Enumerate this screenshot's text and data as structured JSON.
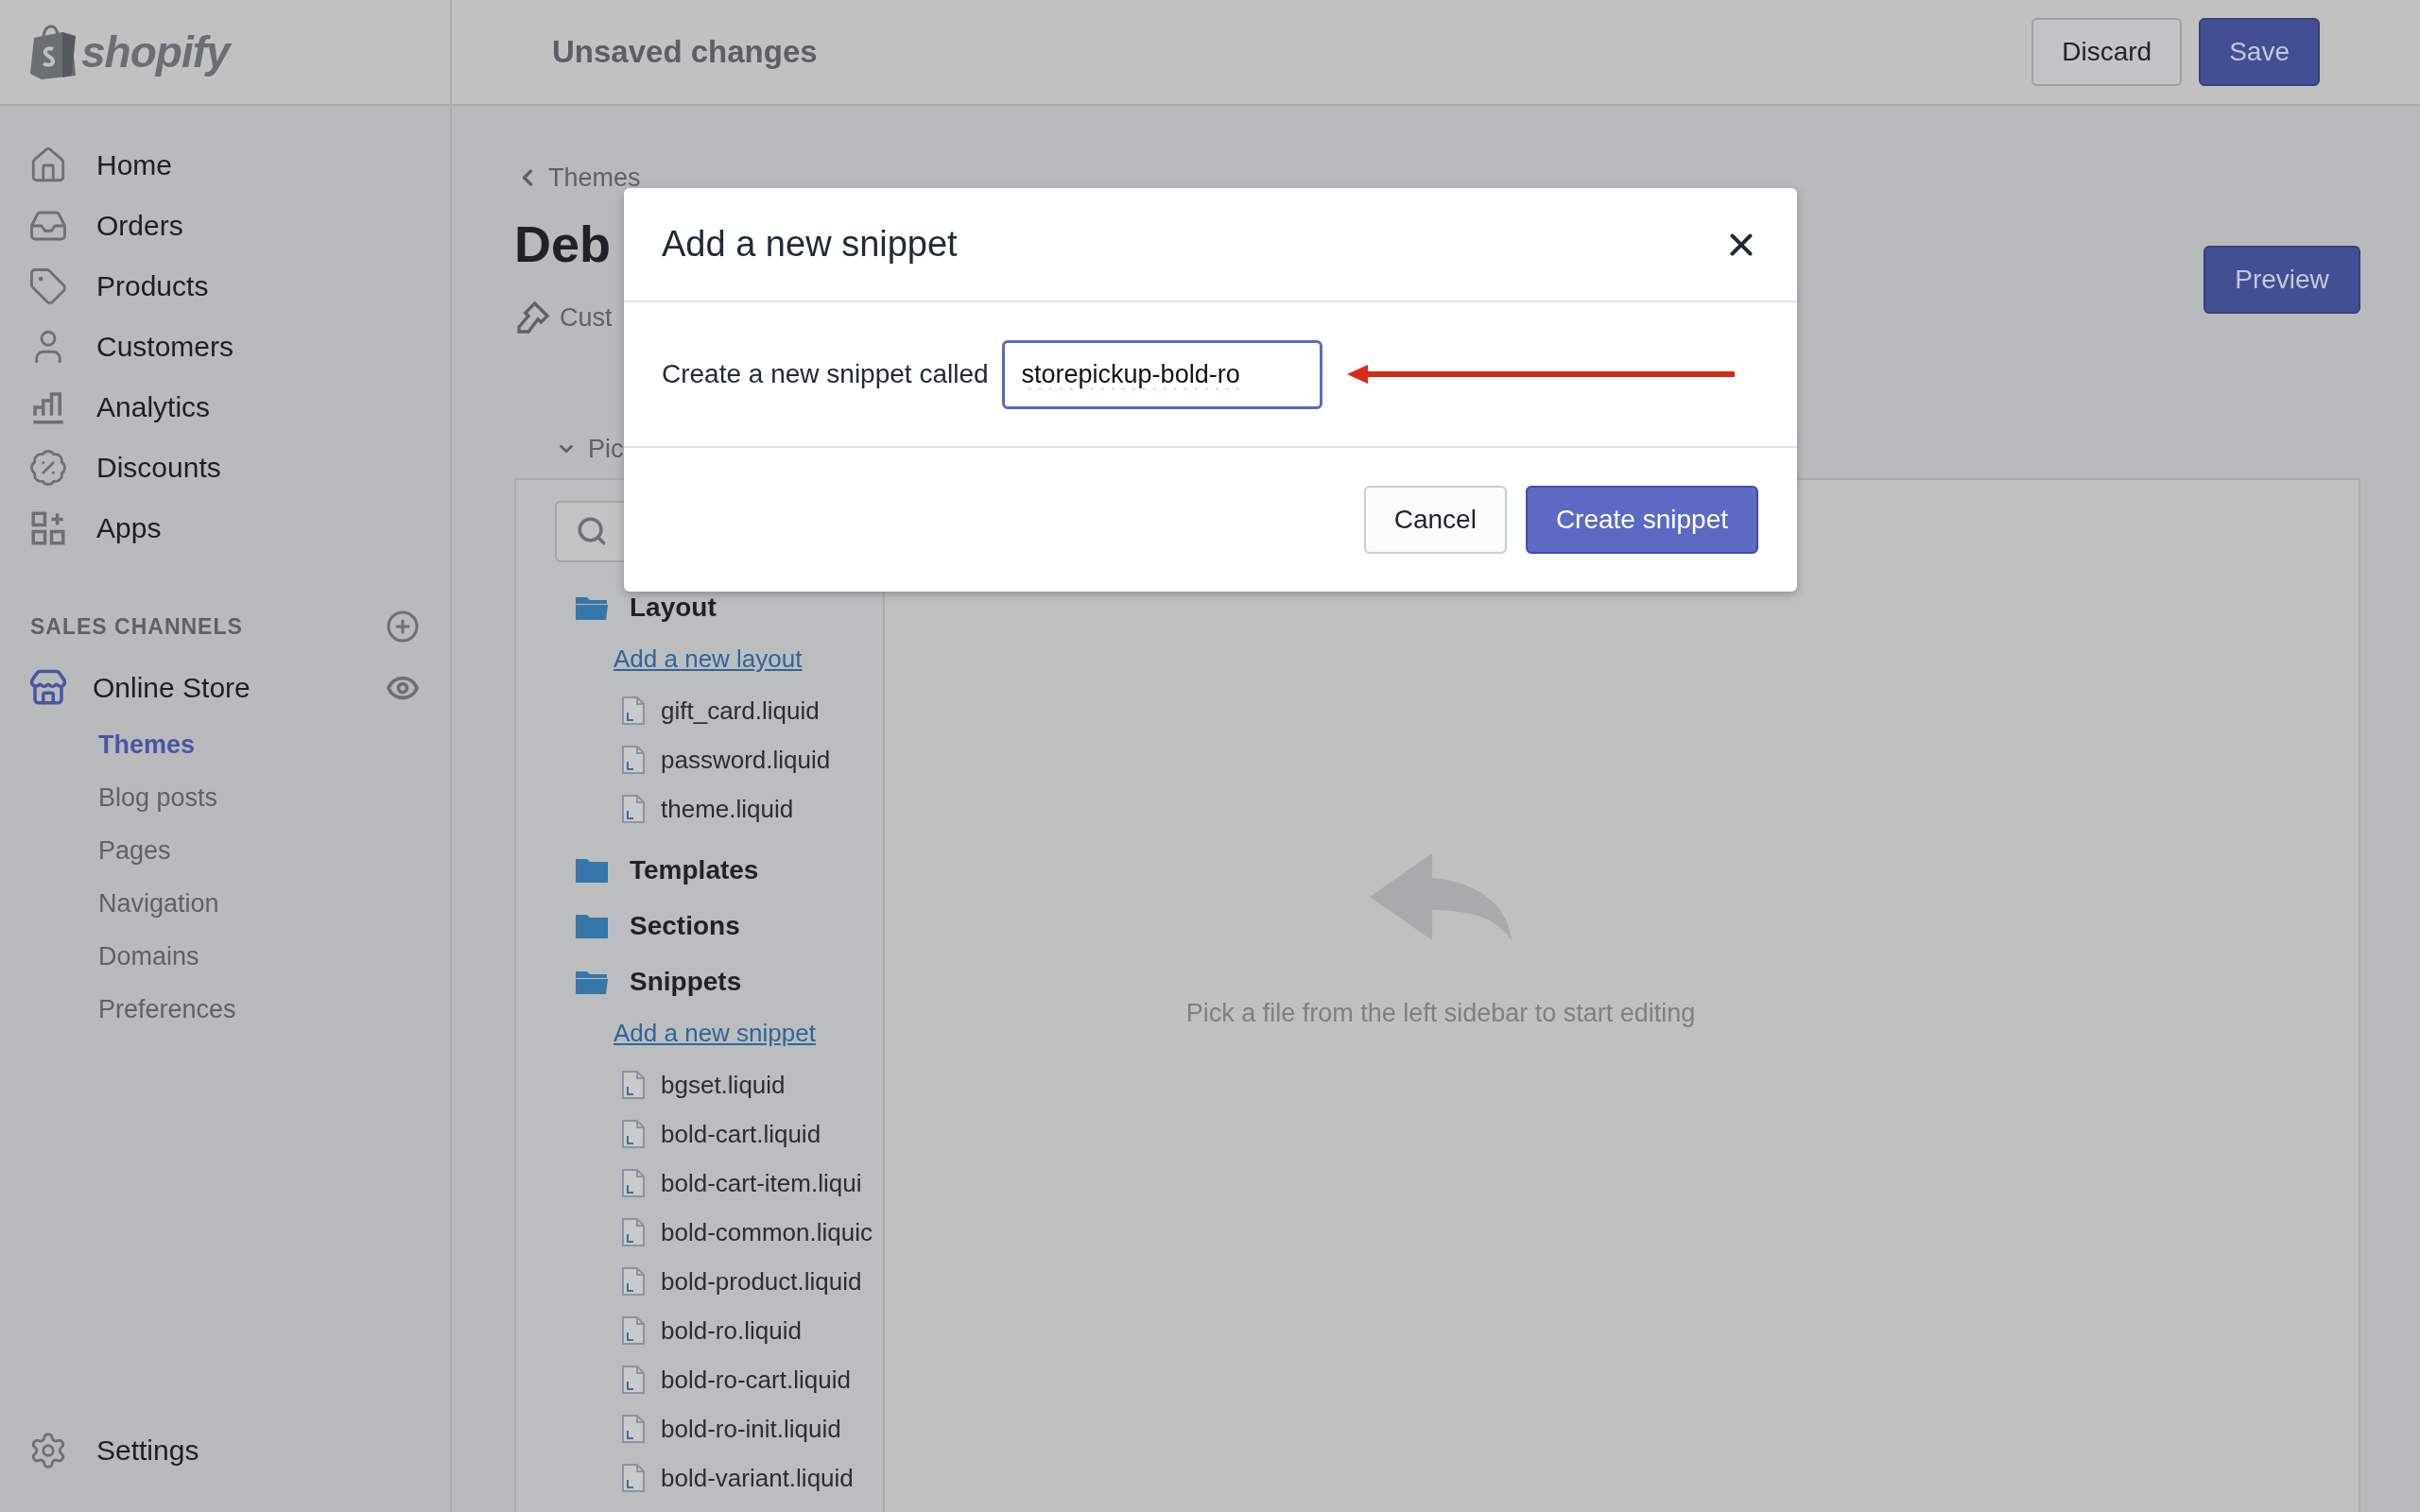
{
  "top_bar": {
    "logo_text": "shopify",
    "title": "Unsaved changes",
    "buttons": [
      {
        "label": "Discard",
        "kind": "secondary"
      },
      {
        "label": "Save",
        "kind": "primary"
      }
    ]
  },
  "sidebar": {
    "items": [
      {
        "label": "Home",
        "selected": false
      },
      {
        "label": "Orders",
        "selected": false
      },
      {
        "label": "Products",
        "selected": false
      },
      {
        "label": "Customers",
        "selected": false
      },
      {
        "label": "Analytics",
        "selected": false
      },
      {
        "label": "Discounts",
        "selected": false
      },
      {
        "label": "Apps",
        "selected": false
      }
    ],
    "sales_channels": {
      "heading": "SALES CHANNELS",
      "channels": [
        {
          "label": "Online Store",
          "items": [
            {
              "label": "Themes",
              "selected": true
            },
            {
              "label": "Blog posts",
              "selected": false
            },
            {
              "label": "Pages",
              "selected": false
            },
            {
              "label": "Navigation",
              "selected": false
            },
            {
              "label": "Domains",
              "selected": false
            },
            {
              "label": "Preferences",
              "selected": false
            }
          ]
        }
      ]
    },
    "settings": "Settings"
  },
  "page": {
    "breadcrumb": "Themes",
    "title": "Deb",
    "subtitle": "Cust",
    "preview_button": "Preview",
    "editor": {
      "section_toggle": {
        "label": "Pic",
        "expanded": true
      },
      "tree": [
        {
          "label": "Layout",
          "expanded": true,
          "add_link": "Add a new layout",
          "files": [
            "gift_card.liquid",
            "password.liquid",
            "theme.liquid"
          ]
        },
        {
          "label": "Templates",
          "expanded": false
        },
        {
          "label": "Sections",
          "expanded": false
        },
        {
          "label": "Snippets",
          "expanded": true,
          "add_link": "Add a new snippet",
          "files": [
            "bgset.liquid",
            "bold-cart.liquid",
            "bold-cart-item.liqui",
            "bold-common.liquic",
            "bold-product.liquid",
            "bold-ro.liquid",
            "bold-ro-cart.liquid",
            "bold-ro-init.liquid",
            "bold-variant.liquid"
          ]
        }
      ],
      "empty_state": "Pick a file from the left sidebar to start editing"
    }
  },
  "dialog": {
    "title": "Add a new snippet",
    "field_label": "Create a new snippet called",
    "field_value": "storepickup-bold-ro",
    "buttons": [
      {
        "label": "Cancel",
        "kind": "secondary"
      },
      {
        "label": "Create snippet",
        "kind": "primary"
      }
    ]
  }
}
